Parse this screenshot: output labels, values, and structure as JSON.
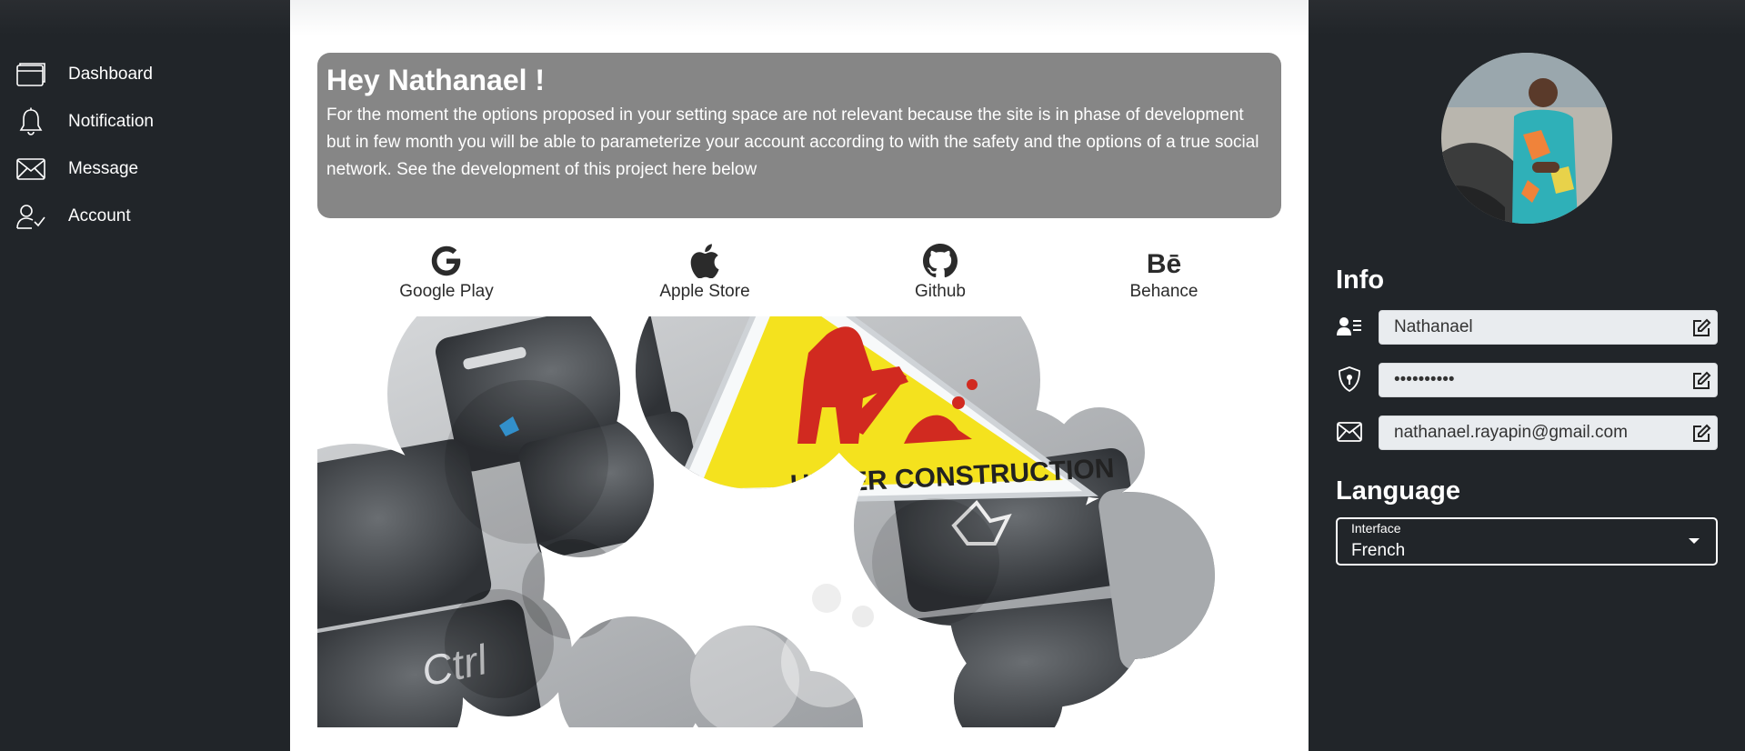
{
  "sidebar": {
    "items": [
      {
        "label": "Dashboard",
        "icon": "browser-window-icon"
      },
      {
        "label": "Notification",
        "icon": "bell-icon"
      },
      {
        "label": "Message",
        "icon": "envelope-icon"
      },
      {
        "label": "Account",
        "icon": "person-check-icon"
      }
    ]
  },
  "welcome": {
    "title": "Hey Nathanael !",
    "text": "For the moment the options proposed in your setting space are not relevant because the site is in phase of development but in few month you will be able to parameterize your account according to with the safety and the options of a true social network. See the development of this project here below"
  },
  "links": [
    {
      "label": "Google Play",
      "icon": "google-icon"
    },
    {
      "label": "Apple Store",
      "icon": "apple-icon"
    },
    {
      "label": "Github",
      "icon": "github-icon"
    },
    {
      "label": "Behance",
      "icon": "behance-icon"
    }
  ],
  "construction_sign": "UNDER CONSTRUCTION",
  "keyboard_key": "Ctrl",
  "info": {
    "title": "Info",
    "name": "Nathanael",
    "password": "••••••••••",
    "email": "nathanael.rayapin@gmail.com"
  },
  "language": {
    "title": "Language",
    "label": "Interface",
    "value": "French"
  },
  "colors": {
    "sidebar_bg": "#212529",
    "welcome_bg": "#868686",
    "field_bg": "#e9ecef"
  }
}
